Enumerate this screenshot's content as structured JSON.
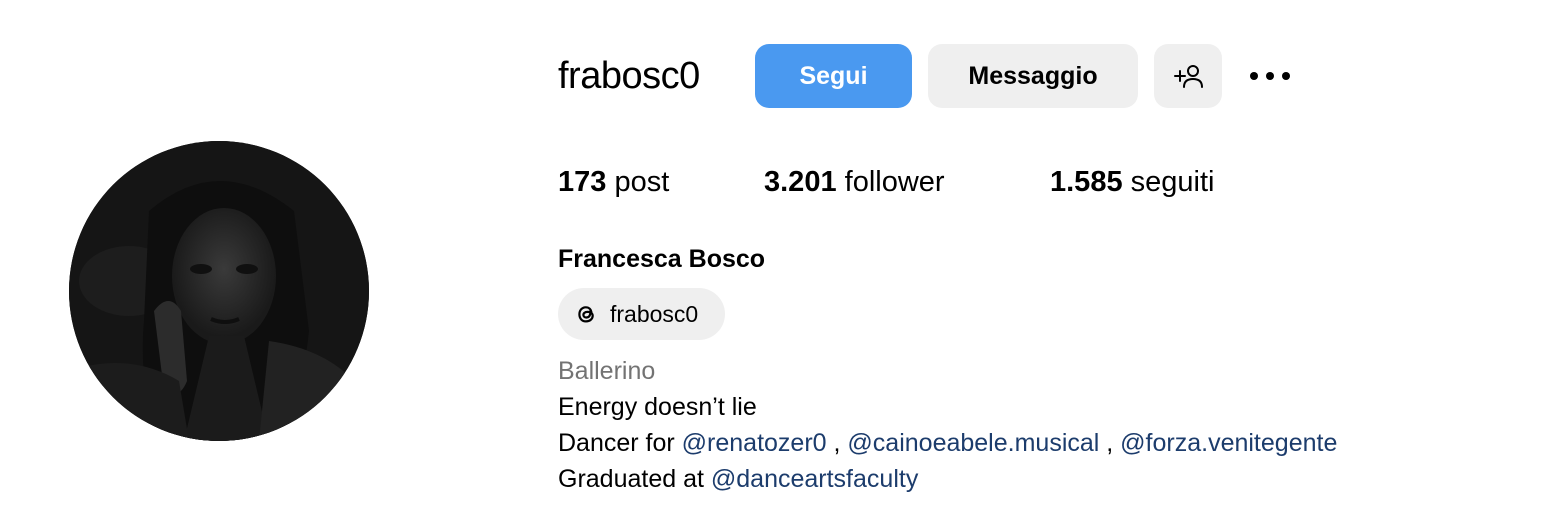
{
  "profile": {
    "username": "frabosc0",
    "full_name": "Francesca Bosco",
    "threads_handle": "frabosc0",
    "category": "Ballerino"
  },
  "actions": {
    "follow_label": "Segui",
    "message_label": "Messaggio",
    "add_user_icon": "add-user-icon",
    "more_icon": "more-horizontal-icon"
  },
  "stats": {
    "posts": {
      "value": "173",
      "label": "post"
    },
    "followers": {
      "value": "3.201",
      "label": "follower"
    },
    "following": {
      "value": "1.585",
      "label": "seguiti"
    }
  },
  "bio": {
    "line1": "Energy doesn’t lie",
    "line2": {
      "prefix": "Dancer for ",
      "mentions": [
        "@renatozer0",
        "@cainoeabele.musical",
        "@forza.venitegente"
      ],
      "separator": " , "
    },
    "line3": {
      "prefix": "Graduated at ",
      "mention": "@danceartsfaculty"
    }
  },
  "colors": {
    "follow_button": "#4a99f0",
    "secondary_button": "#efefef",
    "mention": "#1c3c6c",
    "muted_text": "#737373"
  }
}
